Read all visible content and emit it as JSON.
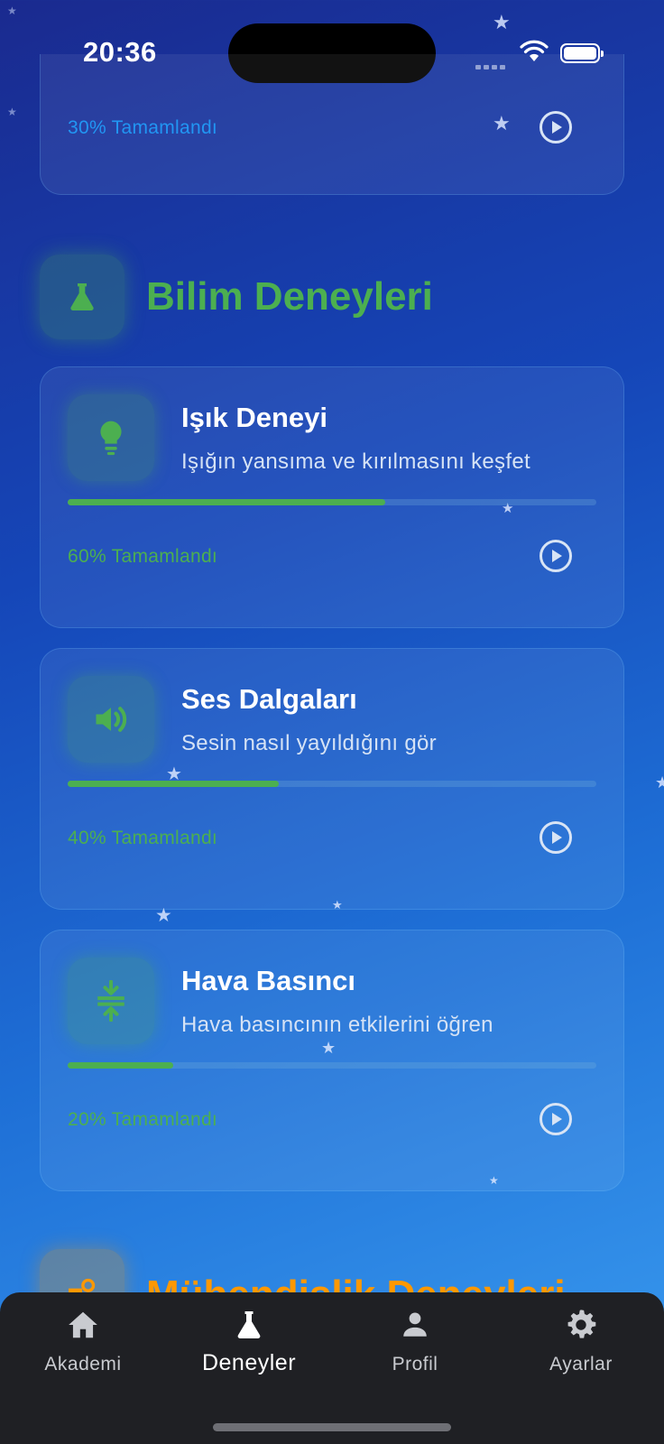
{
  "status": {
    "time": "20:36"
  },
  "top_card": {
    "progress_text": "30% Tamamlandı",
    "progress": 0.3
  },
  "section_science": {
    "title": "Bilim Deneyleri",
    "icon": "flask-icon"
  },
  "experiments": [
    {
      "title": "Işık Deneyi",
      "description": "Işığın yansıma ve kırılmasını keşfet",
      "progress": 0.6,
      "progress_text": "60% Tamamlandı",
      "icon": "lightbulb-icon"
    },
    {
      "title": "Ses Dalgaları",
      "description": "Sesin nasıl yayıldığını gör",
      "progress": 0.4,
      "progress_text": "40% Tamamlandı",
      "icon": "speaker-icon"
    },
    {
      "title": "Hava Basıncı",
      "description": "Hava basıncının etkilerini öğren",
      "progress": 0.2,
      "progress_text": "20% Tamamlandı",
      "icon": "compress-icon"
    }
  ],
  "section_engineering": {
    "title": "Mühendislik Deneyleri",
    "icon": "engineering-icon"
  },
  "nav": [
    {
      "label": "Akademi",
      "icon": "home-icon",
      "active": false
    },
    {
      "label": "Deneyler",
      "icon": "flask-icon",
      "active": true
    },
    {
      "label": "Profil",
      "icon": "person-icon",
      "active": false
    },
    {
      "label": "Ayarlar",
      "icon": "gear-icon",
      "active": false
    }
  ],
  "colors": {
    "science_green": "#4caf50",
    "progress_blue": "#2196f3",
    "engineering_orange": "#ff9800",
    "nav_bg": "#1f2024"
  }
}
